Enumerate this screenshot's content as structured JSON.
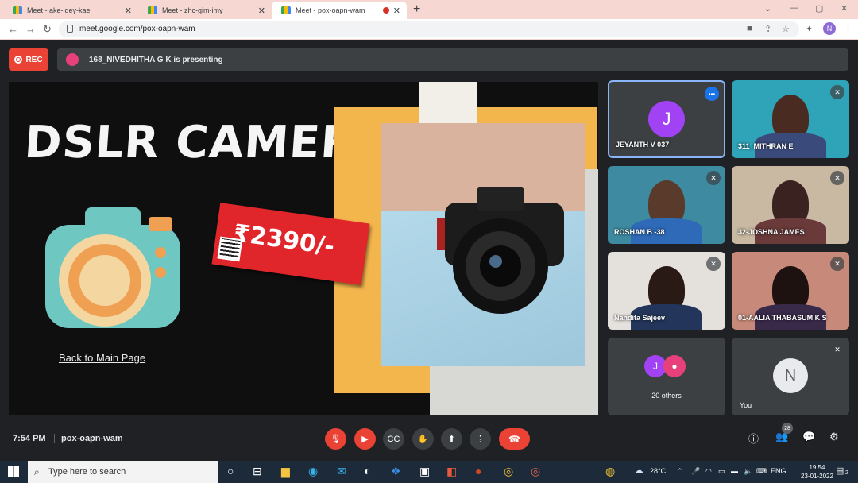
{
  "browser": {
    "tabs": [
      {
        "title": "Meet - ake-jdey-kae",
        "active": false
      },
      {
        "title": "Meet - zhc-gim-imy",
        "active": false
      },
      {
        "title": "Meet - pox-oapn-wam",
        "active": true
      }
    ],
    "url": "meet.google.com/pox-oapn-wam",
    "profile_initial": "N"
  },
  "meet": {
    "rec_label": "REC",
    "presenting_text": "168_NIVEDHITHA G K is presenting",
    "slide": {
      "title": "DSLR CAMERA",
      "price": "₹2390/-",
      "link": "Back to Main Page"
    },
    "participants": [
      {
        "name": "JEYANTH V 037",
        "initial": "J",
        "speaking": true
      },
      {
        "name": "311_MITHRAN E",
        "muted": true
      },
      {
        "name": "ROSHAN B -38",
        "muted": true
      },
      {
        "name": "32-JOSHNA JAMES",
        "muted": true
      },
      {
        "name": "Nandita Sajeev",
        "muted": true
      },
      {
        "name": "01-AALIA THABASUM K S",
        "muted": true
      }
    ],
    "others": {
      "label": "20 others",
      "initials": [
        "J",
        ""
      ]
    },
    "you": {
      "label": "You",
      "initial": "N"
    },
    "time": "7:54 PM",
    "meeting_code": "pox-oapn-wam",
    "people_count": "28"
  },
  "taskbar": {
    "search_placeholder": "Type here to search",
    "temperature": "28°C",
    "language": "ENG",
    "time": "19:54",
    "date": "23-01-2022",
    "notification_count": "2"
  },
  "colors": {
    "meet_bg": "#202124",
    "tile_bg": "#3c4043",
    "danger": "#ea4335",
    "tab_strip": "#f7d7d2"
  }
}
